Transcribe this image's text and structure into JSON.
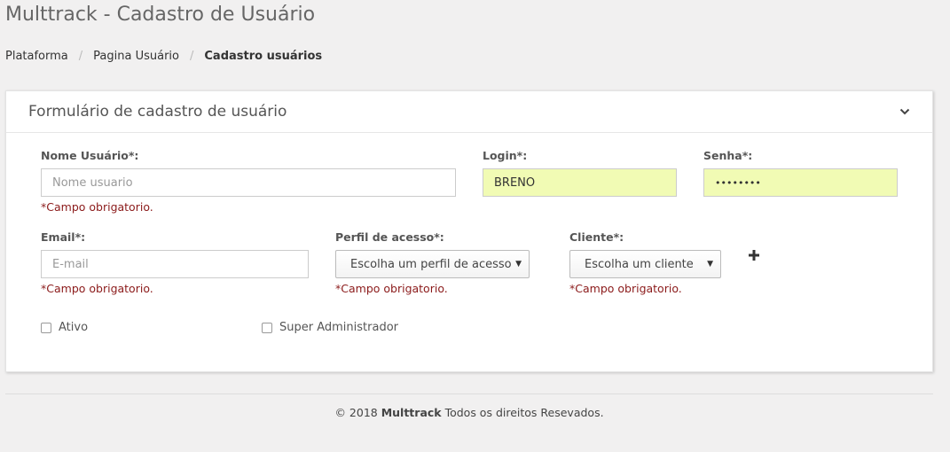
{
  "page": {
    "title": "Multtrack - Cadastro de Usuário"
  },
  "breadcrumb": {
    "items": [
      "Plataforma",
      "Pagina Usuário",
      "Cadastro usuários"
    ],
    "separator": "/"
  },
  "panel": {
    "title": "Formulário de cadastro de usuário",
    "collapse_icon": "chevron-down-icon"
  },
  "form": {
    "nome": {
      "label": "Nome Usuário*:",
      "placeholder": "Nome usuario",
      "value": "",
      "error": "*Campo obrigatorio."
    },
    "login": {
      "label": "Login*:",
      "value": "BRENO"
    },
    "senha": {
      "label": "Senha*:",
      "value": "••••••••"
    },
    "email": {
      "label": "Email*:",
      "placeholder": "E-mail",
      "value": "",
      "error": "*Campo obrigatorio."
    },
    "perfil": {
      "label": "Perfil de acesso*:",
      "selected": "Escolha um perfil de acesso",
      "error": "*Campo obrigatorio."
    },
    "cliente": {
      "label": "Cliente*:",
      "selected": "Escolha um cliente",
      "error": "*Campo obrigatorio."
    },
    "add_cliente_icon": "plus-icon",
    "ativo": {
      "label": "Ativo",
      "checked": false
    },
    "super_admin": {
      "label": "Super Administrador",
      "checked": false
    }
  },
  "footer": {
    "prefix": "© 2018 ",
    "brand": "Multtrack",
    "suffix": " Todos os direitos Resevados."
  },
  "colors": {
    "filled_input_bg": "#f1fbb4",
    "error_text": "#8b1a1a",
    "page_bg": "#f1f0f0"
  }
}
